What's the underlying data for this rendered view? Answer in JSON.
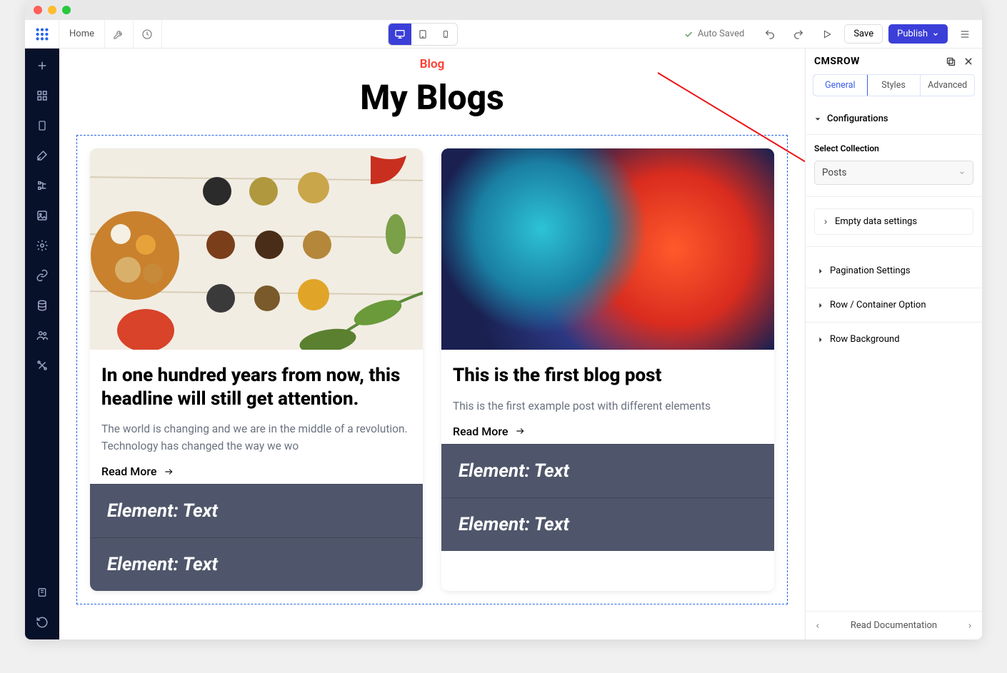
{
  "topbar": {
    "home": "Home",
    "auto_saved": "Auto Saved",
    "save": "Save",
    "publish": "Publish"
  },
  "page": {
    "tag": "Blog",
    "title": "My Blogs"
  },
  "cards": [
    {
      "headline": "In one hundred years from now, this headline will still get attention.",
      "excerpt": "The world is changing and we are in the middle of a revolution. Technology has changed the way we wo",
      "readmore": "Read More",
      "element1": "Element: Text",
      "element2": "Element: Text"
    },
    {
      "headline": "This is the first blog post",
      "excerpt": "This is the first example post with different elements",
      "readmore": "Read More",
      "element1": "Element: Text",
      "element2": "Element: Text"
    }
  ],
  "panel": {
    "title": "CMSROW",
    "tabs": {
      "general": "General",
      "styles": "Styles",
      "advanced": "Advanced"
    },
    "config_heading": "Configurations",
    "select_label": "Select Collection",
    "select_value": "Posts",
    "empty_data": "Empty data settings",
    "pagination": "Pagination Settings",
    "row_option": "Row / Container Option",
    "row_bg": "Row Background",
    "footer": "Read Documentation"
  }
}
